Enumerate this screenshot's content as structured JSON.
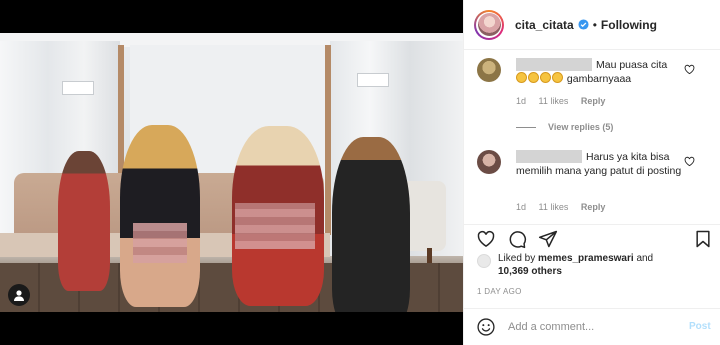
{
  "header": {
    "username": "cita_citata",
    "separator": "•",
    "following_label": "Following"
  },
  "comments": [
    {
      "text": "Mau puasa cita",
      "text_line2": "gambarnyaaa",
      "likes": "11 likes",
      "time": "1d",
      "reply_label": "Reply",
      "view_replies": "View replies (5)"
    },
    {
      "text": "Harus ya kita bisa memilih mana yang patut di posting",
      "likes": "11 likes",
      "time": "1d",
      "reply_label": "Reply"
    }
  ],
  "likes": {
    "prefix": "Liked by",
    "user": "memes_prameswari",
    "and": "and",
    "others": "10,369 others"
  },
  "post_time": "1 DAY AGO",
  "add_comment": {
    "placeholder": "Add a comment...",
    "post_label": "Post"
  },
  "colors": {
    "verified": "#3897f0",
    "post_disabled": "#b2dffc",
    "text_primary": "#262626",
    "text_secondary": "#8e8e8e"
  },
  "icons": [
    "heart-icon",
    "comment-icon",
    "share-icon",
    "bookmark-icon",
    "smile-icon",
    "user-tag-icon",
    "verified-icon"
  ]
}
